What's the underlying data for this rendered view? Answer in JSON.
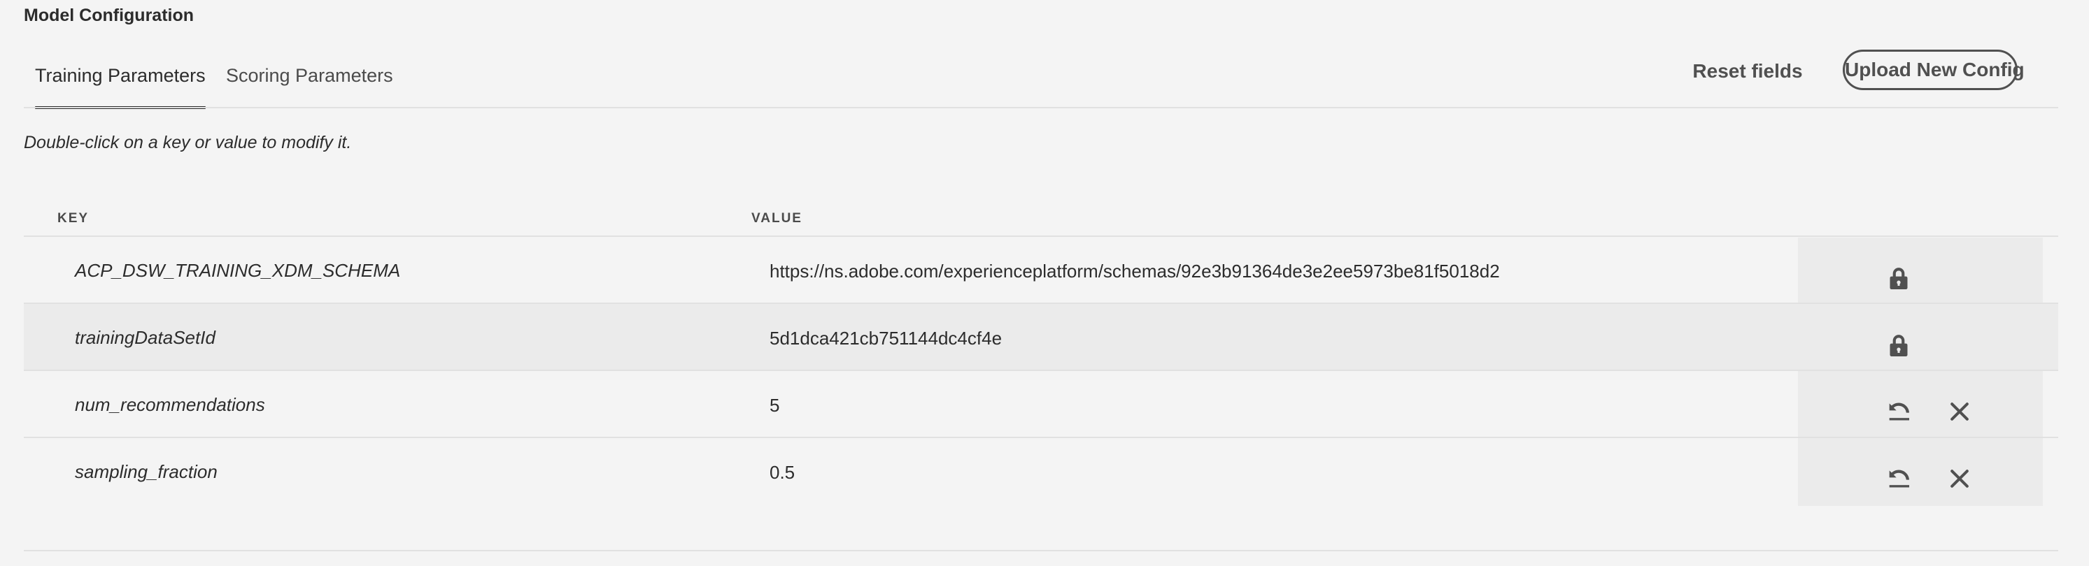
{
  "title": "Model Configuration",
  "tabs": [
    {
      "label": "Training Parameters",
      "active": true
    },
    {
      "label": "Scoring Parameters",
      "active": false
    }
  ],
  "actions": {
    "reset_label": "Reset fields",
    "upload_label": "Upload New Config"
  },
  "hint": "Double-click on a key or value to modify it.",
  "table": {
    "headers": {
      "key": "KEY",
      "value": "VALUE"
    },
    "rows": [
      {
        "key": "ACP_DSW_TRAINING_XDM_SCHEMA",
        "value": "https://ns.adobe.com/experienceplatform/schemas/92e3b91364de3e2ee5973be81f5018d2",
        "locked": true,
        "icons": [
          "lock-icon"
        ]
      },
      {
        "key": "trainingDataSetId",
        "value": "5d1dca421cb751144dc4cf4e",
        "locked": true,
        "icons": [
          "lock-icon"
        ]
      },
      {
        "key": "num_recommendations",
        "value": "5",
        "locked": false,
        "icons": [
          "undo-icon",
          "close-icon"
        ]
      },
      {
        "key": "sampling_fraction",
        "value": "0.5",
        "locked": false,
        "icons": [
          "undo-icon",
          "close-icon"
        ]
      }
    ]
  }
}
